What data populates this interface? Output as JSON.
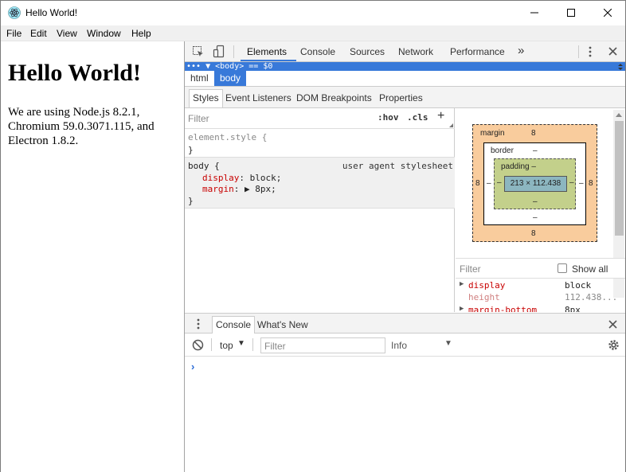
{
  "window": {
    "title": "Hello World!",
    "icons": {
      "app": "electron-atom-icon",
      "minimize": "minimize-icon",
      "maximize": "maximize-icon",
      "close": "close-icon"
    }
  },
  "menu": {
    "file": "File",
    "edit": "Edit",
    "view": "View",
    "window": "Window",
    "help": "Help"
  },
  "page": {
    "heading": "Hello World!",
    "text": "We are using Node.js 8.2.1, Chromium 59.0.3071.115, and Electron 1.8.2."
  },
  "devtools": {
    "tabs": {
      "elements": "Elements",
      "console": "Console",
      "sources": "Sources",
      "network": "Network",
      "performance": "Performance",
      "more": "»"
    },
    "dom_row": "••• ▼ <body> == $0",
    "breadcrumbs": {
      "html": "html",
      "body": "body"
    },
    "subtabs": {
      "styles": "Styles",
      "event_listeners": "Event Listeners",
      "dom_breakpoints": "DOM Breakpoints",
      "properties": "Properties"
    },
    "styles": {
      "filter_placeholder": "Filter",
      "hov": ":hov",
      "cls": ".cls",
      "add": "+",
      "element_style_open": "element.style {",
      "element_style_close": "}",
      "body_selector": "body {",
      "ua_label": "user agent stylesheet",
      "display_prop": "display",
      "display_value": ": block;",
      "margin_prop": "margin",
      "margin_value": ": ▶ 8px;",
      "body_close": "}"
    },
    "box_model": {
      "margin_label": "margin",
      "margin_top": "8",
      "margin_bottom": "8",
      "margin_left": "8",
      "margin_right": "8",
      "border_label": "border",
      "border_top": "–",
      "border_bottom": "–",
      "border_left": "–",
      "border_right": "–",
      "padding_label": "padding –",
      "padding_bottom": "–",
      "padding_left": "–",
      "padding_right": "–",
      "content_size": "213 × 112.438"
    },
    "computed": {
      "filter_placeholder": "Filter",
      "show_all": "Show all",
      "rows": [
        {
          "prop": "display",
          "value": "block"
        },
        {
          "prop": "height",
          "value": "112.438..."
        },
        {
          "prop": "margin-bottom",
          "value": "8px"
        }
      ]
    },
    "drawer": {
      "console_tab": "Console",
      "whats_new_tab": "What's New"
    },
    "console": {
      "context": "top",
      "filter_placeholder": "Filter",
      "level": "Info",
      "prompt": "›"
    },
    "colors": {
      "accent": "#3879d9",
      "margin": "#f9cc9d",
      "padding": "#c3d08b",
      "content": "#8cb6c0",
      "css_property": "#c80000"
    }
  }
}
